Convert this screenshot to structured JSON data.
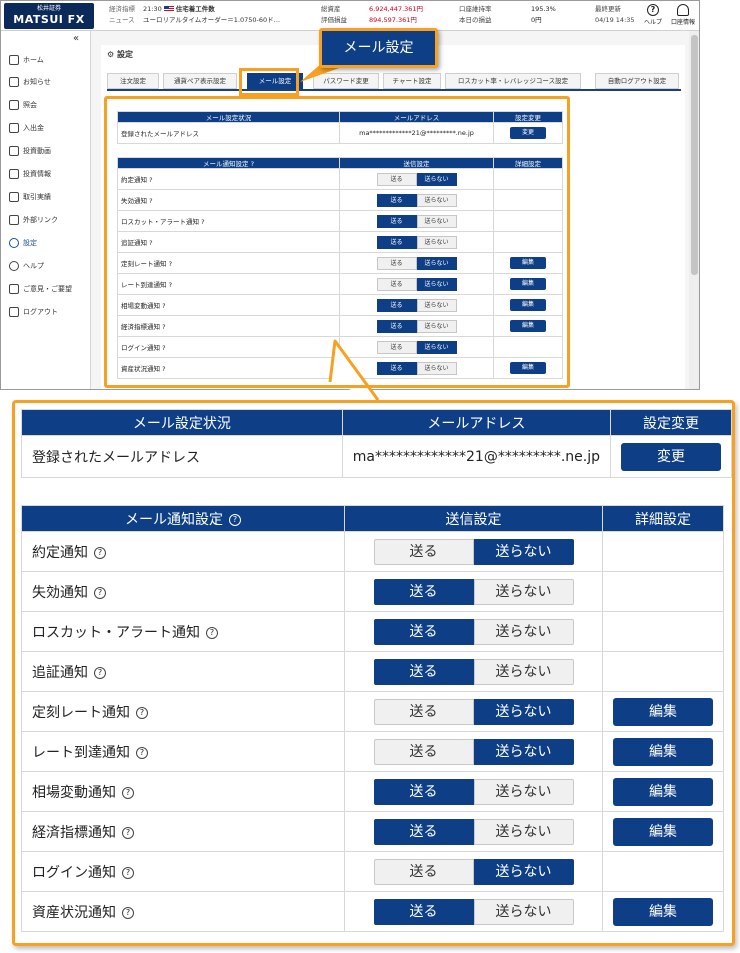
{
  "header": {
    "logo_top": "松井証券",
    "logo_main": "MATSUI FX",
    "ticker_label1": "経済指標",
    "ticker_time": "21:30",
    "ticker_event": "住宅着工件数",
    "ticker_label2": "ニュース",
    "ticker_news": "ユーロリアルタイムオーダー＝1.0750-60ド…",
    "total_assets_label": "総資産",
    "total_assets_value": "6,924,447.361円",
    "margin_label": "評価損益",
    "margin_value": "894,597.361円",
    "ratio_label": "口座維持率",
    "ratio_value": "195.3%",
    "today_pl_label": "本日の損益",
    "today_pl_value": "0円",
    "updated_label": "最終更新",
    "updated_value": "04/19 14:35",
    "help_label": "ヘルプ",
    "account_label": "口座情報"
  },
  "sidebar": {
    "collapse": "«",
    "items": [
      {
        "label": "ホーム"
      },
      {
        "label": "お知らせ"
      },
      {
        "label": "照会"
      },
      {
        "label": "入出金"
      },
      {
        "label": "投資動画"
      },
      {
        "label": "投資情報"
      },
      {
        "label": "取引実績"
      },
      {
        "label": "外部リンク"
      },
      {
        "label": "設定"
      },
      {
        "label": "ヘルプ"
      },
      {
        "label": "ご意見・ご要望"
      },
      {
        "label": "ログアウト"
      }
    ]
  },
  "panel": {
    "title": "設定",
    "tabs": [
      "注文設定",
      "通貨ペア表示設定",
      "メール設定",
      "パスワード変更",
      "チャート設定",
      "ロスカット率・レバレッジコース設定",
      "自動ログアウト設定"
    ]
  },
  "callout": {
    "label": "メール設定"
  },
  "mail_status": {
    "headers": [
      "メール設定状況",
      "メールアドレス",
      "設定変更"
    ],
    "row_label": "登録されたメールアドレス",
    "address": "ma*************21@*********.ne.jp",
    "change_button": "変更"
  },
  "notifications": {
    "headers": [
      "メール通知設定",
      "送信設定",
      "詳細設定"
    ],
    "send_label": "送る",
    "nosend_label": "送らない",
    "edit_label": "編集",
    "help_glyph": "?",
    "rows": [
      {
        "label": "約定通知",
        "send": false,
        "edit": false
      },
      {
        "label": "失効通知",
        "send": true,
        "edit": false
      },
      {
        "label": "ロスカット・アラート通知",
        "send": true,
        "edit": false
      },
      {
        "label": "追証通知",
        "send": true,
        "edit": false
      },
      {
        "label": "定刻レート通知",
        "send": false,
        "edit": true
      },
      {
        "label": "レート到達通知",
        "send": false,
        "edit": true
      },
      {
        "label": "相場変動通知",
        "send": true,
        "edit": true
      },
      {
        "label": "経済指標通知",
        "send": true,
        "edit": true
      },
      {
        "label": "ログイン通知",
        "send": false,
        "edit": false
      },
      {
        "label": "資産状況通知",
        "send": true,
        "edit": true
      }
    ]
  },
  "colors": {
    "accent": "#0e3f86",
    "callout": "#f7a021",
    "alert_red": "#d0021b"
  }
}
